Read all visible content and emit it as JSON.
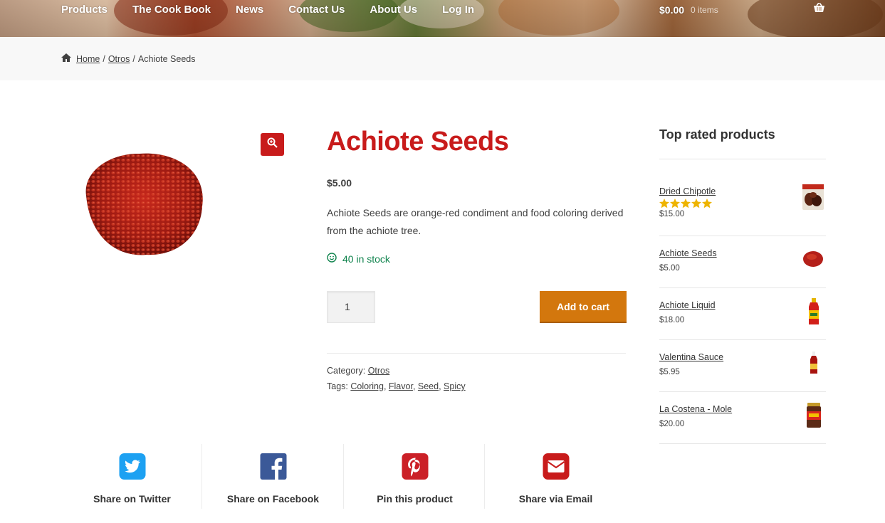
{
  "header": {
    "nav": [
      "Products",
      "The Cook Book",
      "News",
      "Contact Us",
      "About Us",
      "Log In"
    ],
    "cart_amount": "$0.00",
    "cart_items": "0 items"
  },
  "breadcrumb": {
    "home": "Home",
    "sep": "/",
    "category": "Otros",
    "current": "Achiote Seeds"
  },
  "product": {
    "title": "Achiote Seeds",
    "price": "$5.00",
    "description": "Achiote Seeds are orange-red condiment and food coloring derived from the achiote tree.",
    "stock": "40 in stock",
    "quantity": "1",
    "add_to_cart": "Add to cart",
    "category_label": "Category:",
    "category": "Otros",
    "tags_label": "Tags:",
    "tags": [
      "Coloring",
      "Flavor",
      "Seed",
      "Spicy"
    ]
  },
  "sidebar": {
    "title": "Top rated products",
    "items": [
      {
        "name": "Dried Chipotle",
        "price": "$15.00",
        "rating": 5
      },
      {
        "name": "Achiote Seeds",
        "price": "$5.00"
      },
      {
        "name": "Achiote Liquid",
        "price": "$18.00"
      },
      {
        "name": "Valentina Sauce",
        "price": "$5.95"
      },
      {
        "name": "La Costena - Mole",
        "price": "$20.00"
      }
    ]
  },
  "share": [
    {
      "label": "Share on Twitter",
      "icon": "twitter-icon"
    },
    {
      "label": "Share on Facebook",
      "icon": "facebook-icon"
    },
    {
      "label": "Pin this product",
      "icon": "pinterest-icon"
    },
    {
      "label": "Share via Email",
      "icon": "email-icon"
    }
  ],
  "colors": {
    "brand_red": "#c81b1b",
    "button_orange": "#d3770d",
    "stock_green": "#0f834d",
    "star_gold": "#eeb401"
  }
}
